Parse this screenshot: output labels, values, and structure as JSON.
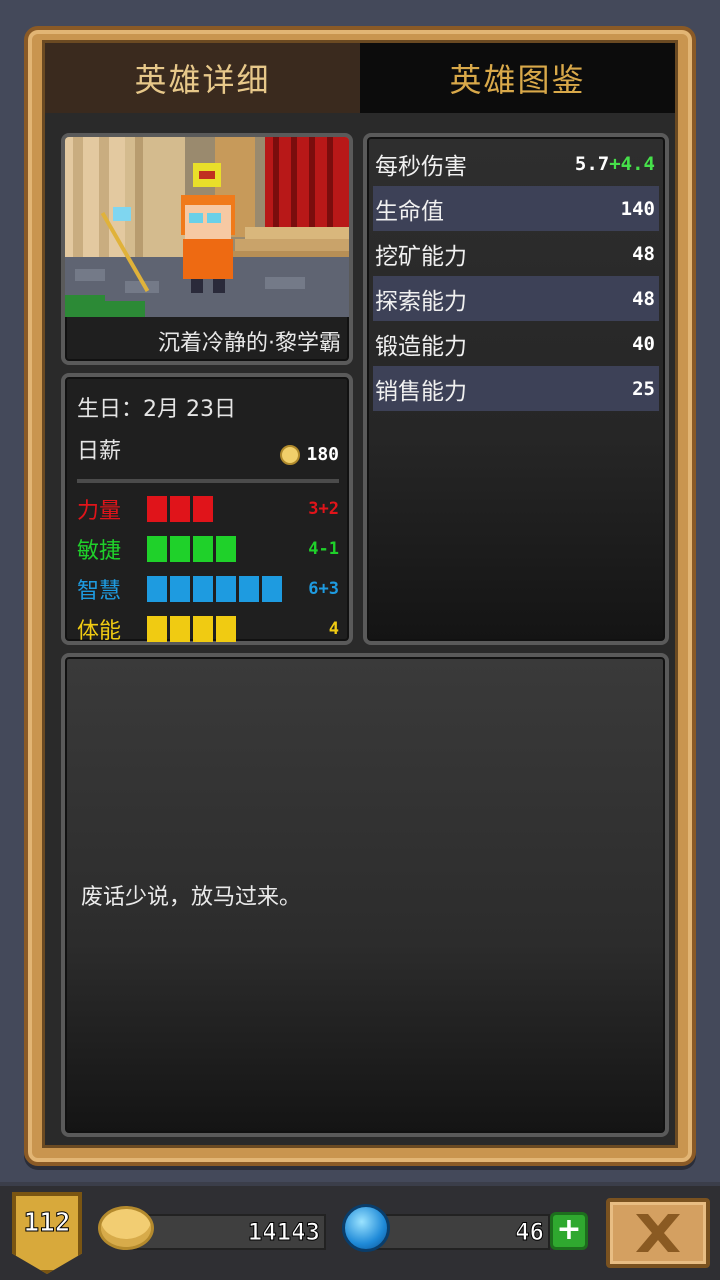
{
  "tabs": [
    {
      "label": "英雄详细",
      "active": true
    },
    {
      "label": "英雄图鉴",
      "active": false
    }
  ],
  "hero": {
    "name": "沉着冷静的·黎学霸",
    "birthday_label": "生日：",
    "birthday": "2月 23日",
    "wage_label": "日薪",
    "wage": "180"
  },
  "attributes": [
    {
      "label": "力量",
      "bars": 3,
      "value": "3+2",
      "color": "#e0141a"
    },
    {
      "label": "敏捷",
      "bars": 4,
      "value": "4-1",
      "color": "#1fd12a"
    },
    {
      "label": "智慧",
      "bars": 6,
      "value": "6+3",
      "color": "#1e9be0"
    },
    {
      "label": "体能",
      "bars": 4,
      "value": "4",
      "color": "#f0cb12"
    }
  ],
  "stats": [
    {
      "label": "每秒伤害",
      "value": "5.7",
      "bonus": "+4.4"
    },
    {
      "label": "生命值",
      "value": "140",
      "bonus": ""
    },
    {
      "label": "挖矿能力",
      "value": "48",
      "bonus": ""
    },
    {
      "label": "探索能力",
      "value": "48",
      "bonus": ""
    },
    {
      "label": "锻造能力",
      "value": "40",
      "bonus": ""
    },
    {
      "label": "销售能力",
      "value": "25",
      "bonus": ""
    }
  ],
  "description": "废话少说，放马过来。",
  "bottom": {
    "level": "112",
    "gold": "14143",
    "gems": "46",
    "plus_label": "+"
  },
  "icons": {
    "coin": "coin-icon",
    "gem": "gem-icon",
    "close": "close-icon",
    "plus": "plus-icon",
    "level_badge": "shield-icon"
  }
}
